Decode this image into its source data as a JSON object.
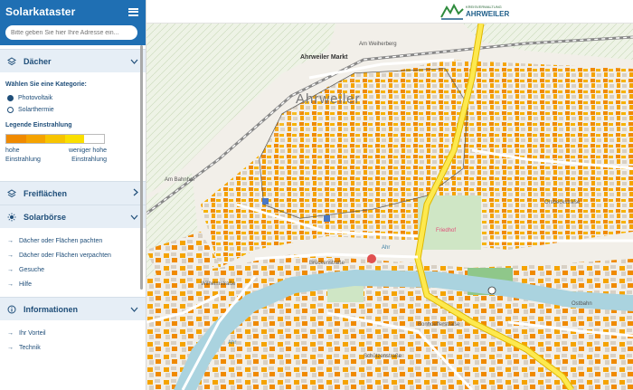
{
  "sidebar": {
    "title": "Solarkataster",
    "search_placeholder": "Bitte geben Sie hier Ihre Adresse ein...",
    "sections": {
      "daecher": "Dächer",
      "freiflaechen": "Freiflächen",
      "solarboerse": "Solarbörse",
      "informationen": "Informationen"
    },
    "category_title": "Wählen Sie eine Kategorie:",
    "categories": [
      "Photovoltaik",
      "Solarthermie"
    ],
    "selected_category": "Photovoltaik",
    "legend": {
      "title": "Legende Einstrahlung",
      "colors": [
        "#f08a00",
        "#f5a300",
        "#f7c400",
        "#fadf00",
        "#ffffff"
      ],
      "left_label_1": "hohe",
      "left_label_2": "Einstrahlung",
      "right_label_1": "weniger hohe",
      "right_label_2": "Einstrahlung"
    },
    "boerse_links": [
      "Dächer oder Flächen pachten",
      "Dächer oder Flächen verpachten",
      "Gesuche",
      "Hilfe"
    ],
    "info_links": [
      "Ihr Vorteil",
      "Technik"
    ]
  },
  "logo": {
    "small_text": "KREISVERWALTUNG",
    "big_text": "AHRWEILER"
  },
  "map": {
    "town_label": "Ahrweiler",
    "labels": {
      "markt": "Ahrweiler Markt",
      "friedhof": "Friedhof",
      "ahr1": "Ahr",
      "ahr2": "Ahr",
      "brueckenstr": "Brückenstraße",
      "wilhelmstr": "Wilhelmstraße",
      "bonhoeffer": "Bonhoefferstraße",
      "ostbahn": "Ostbahn",
      "am_weiherberg": "Am Weiherberg",
      "orsbeckstr": "Orsbeckstraße",
      "wilhelm": "Wilhelm-",
      "plateau": "Plateau",
      "pfarrfr": "Pfarrfr.",
      "schuetzen": "Schützenstraße",
      "am_bahnhof": "Am Bahnhof",
      "wolfstr": "Wolfsstraße"
    }
  }
}
